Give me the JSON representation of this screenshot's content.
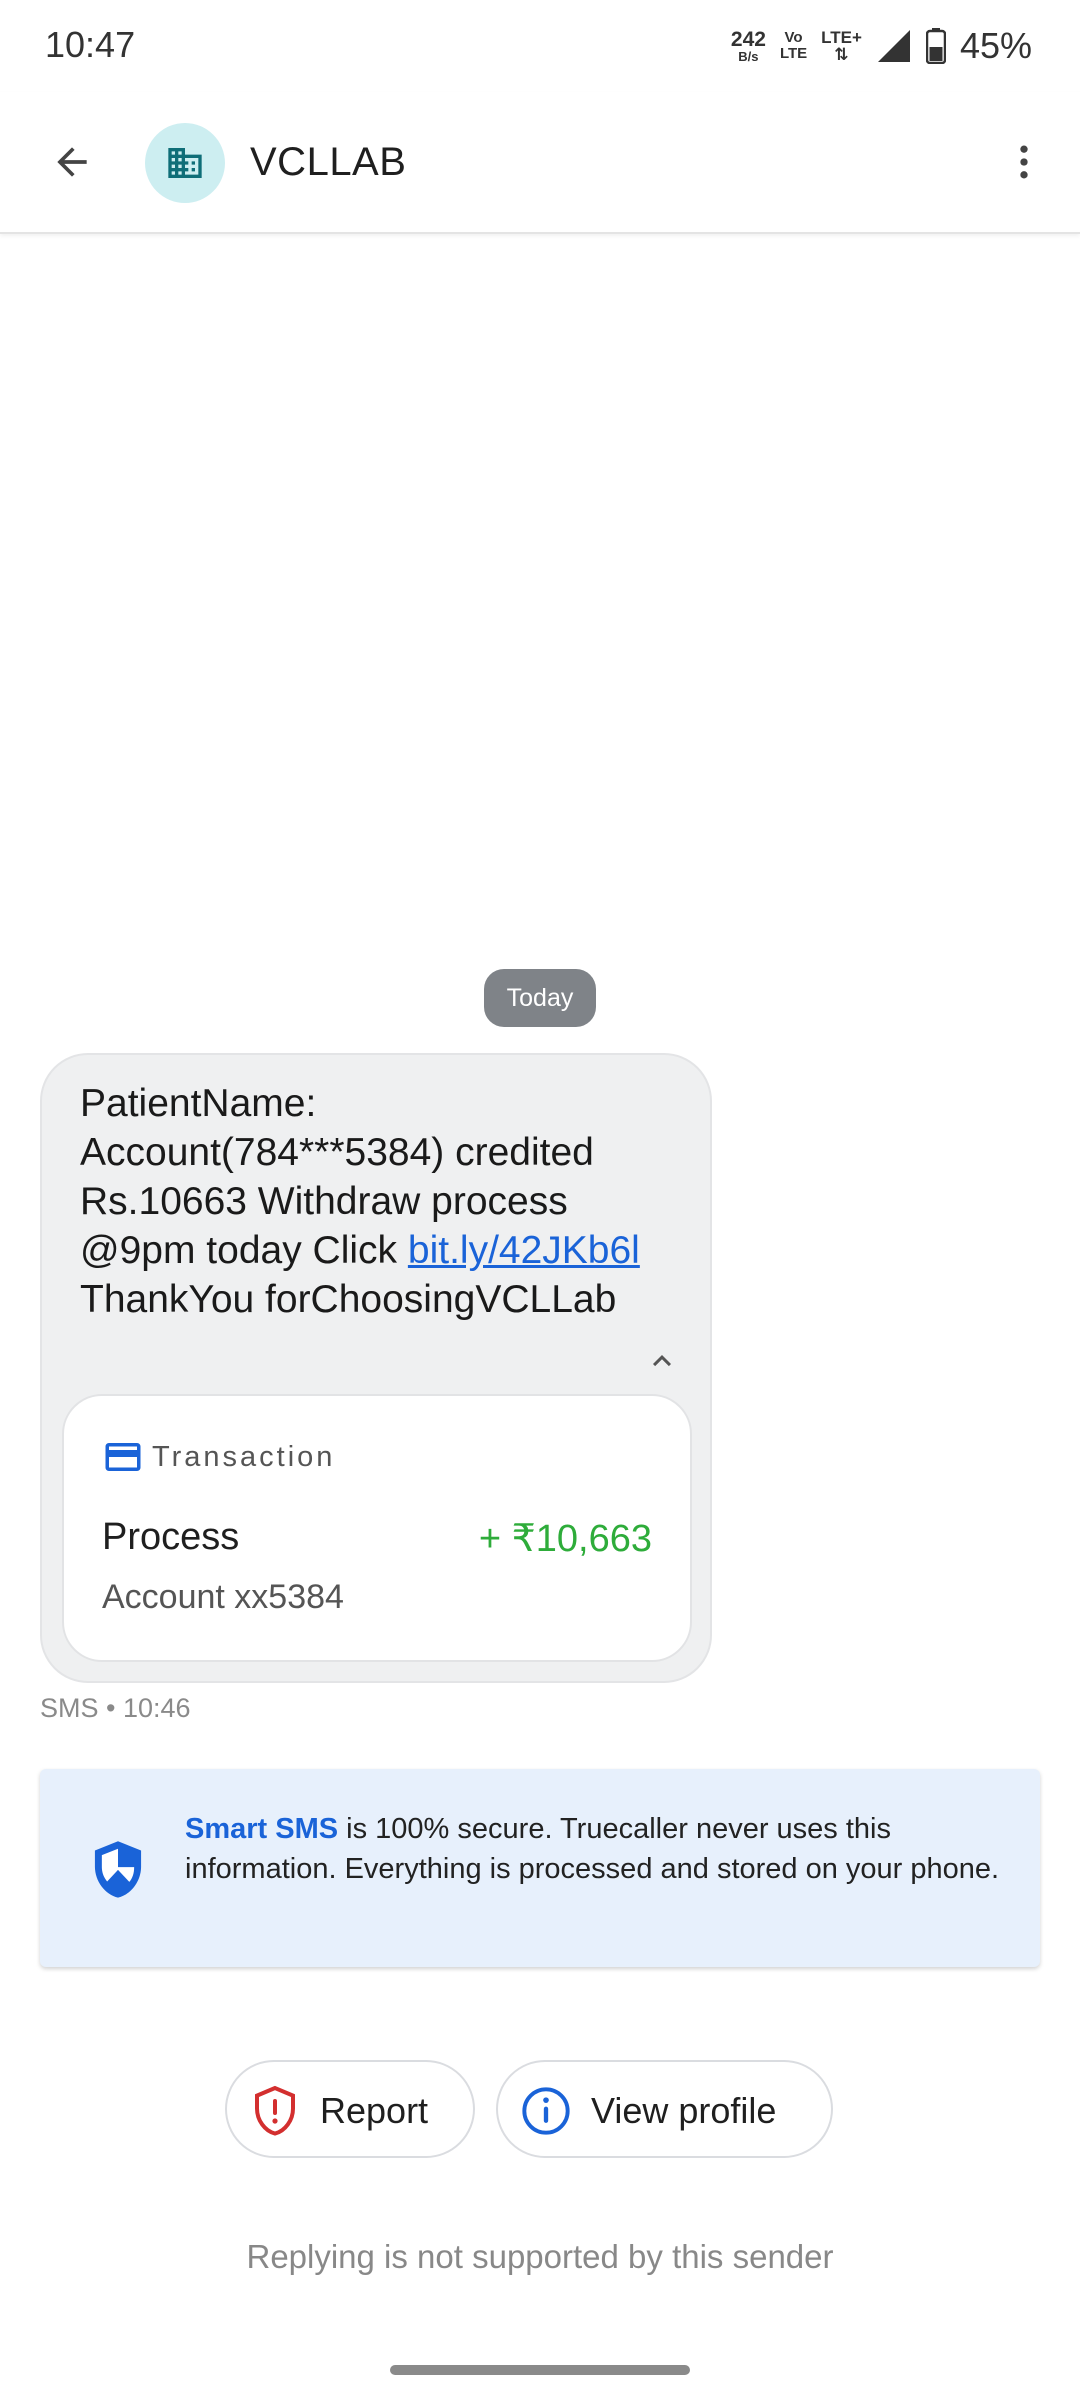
{
  "status_bar": {
    "time": "10:47",
    "net_speed_value": "242",
    "net_speed_unit": "B/s",
    "volte_top": "Vo",
    "volte_bottom": "LTE",
    "lte_label": "LTE+",
    "lte_arrows": "⇅",
    "battery_percent": "45%"
  },
  "header": {
    "sender": "VCLLAB",
    "icons": {
      "back": "arrow-back-icon",
      "avatar": "business-building-icon",
      "more": "more-vertical-icon"
    }
  },
  "conversation": {
    "date_chip": "Today",
    "message": {
      "text_before_link": "PatientName: Account(784***5384) credited Rs.10663 Withdraw process @9pm today Click",
      "link": "bit.ly/42JKb6l",
      "text_after_link": "ThankYou forChoosingVCLLab",
      "meta": "SMS • 10:46"
    },
    "transaction": {
      "title": "Transaction",
      "label": "Process",
      "amount": "+ ₹10,663",
      "account": "Account xx5384"
    }
  },
  "info_banner": {
    "highlight": "Smart SMS",
    "text": "is 100% secure. Truecaller never uses this information. Everything is processed and stored on your phone."
  },
  "actions": {
    "report_label": "Report",
    "profile_label": "View profile"
  },
  "footer_note": "Replying is not supported by this sender",
  "colors": {
    "accent_blue": "#1a63d8",
    "amount_green": "#2eac3a",
    "report_red": "#d32f2f",
    "banner_bg": "#e7f0fc",
    "avatar_bg": "#cdeef1",
    "avatar_icon": "#0f6e78"
  }
}
